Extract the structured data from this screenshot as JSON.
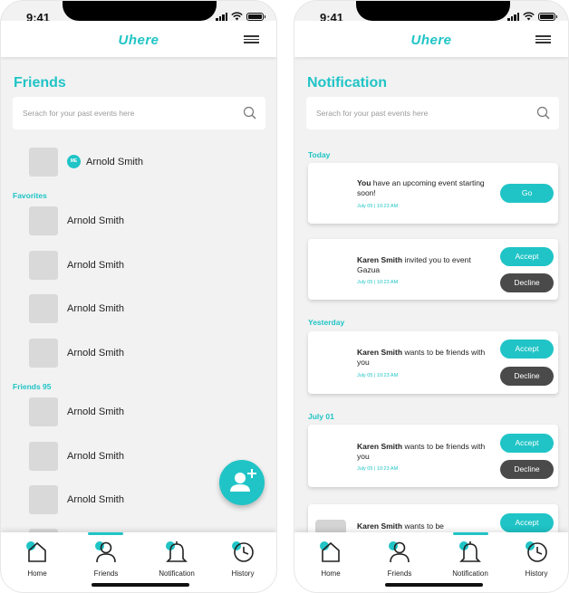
{
  "status_bar": {
    "time": "9:41"
  },
  "app": {
    "logo": "Uhere"
  },
  "friends_screen": {
    "title": "Friends",
    "search": {
      "placeholder": "Serach for your past events here"
    },
    "me": {
      "badge": "ME",
      "name": "Arnold Smith"
    },
    "favorites_label": "Favorites",
    "favorites": [
      "Arnold Smith",
      "Arnold Smith",
      "Arnold Smith",
      "Arnold Smith"
    ],
    "friends_label": "Friends 95",
    "friends": [
      "Arnold Smith",
      "Arnold Smith",
      "Arnold Smith"
    ]
  },
  "notification_screen": {
    "title": "Notification",
    "search": {
      "placeholder": "Serach for your past events here"
    },
    "groups": {
      "today": "Today",
      "yesterday": "Yesterday",
      "july01": "July 01"
    },
    "cards": [
      {
        "bold": "You",
        "text": " have an upcoming event starting soon!",
        "time": "July 05 | 10:23 AM",
        "primary": "Go"
      },
      {
        "bold": "Karen Smith",
        "text": "  invited  you to event Gazua",
        "time": "July 05 | 10:23 AM",
        "primary": "Accept",
        "secondary": "Decline"
      },
      {
        "bold": "Karen Smith",
        "text": " wants to be friends with you",
        "time": "July 05 | 10:23 AM",
        "primary": "Accept",
        "secondary": "Decline"
      },
      {
        "bold": "Karen Smith",
        "text": " wants to be friends with you",
        "time": "July 05 | 10:23 AM",
        "primary": "Accept",
        "secondary": "Decline"
      },
      {
        "bold": "Karen Smith",
        "text": " wants to be",
        "primary": "Accept"
      }
    ]
  },
  "nav": {
    "home": "Home",
    "friends": "Friends",
    "notification": "Notification",
    "history": "History"
  },
  "icons": {
    "menu": "menu-icon",
    "search": "search-icon",
    "add_friend": "add-user-icon",
    "home": "home-icon",
    "friends": "user-icon",
    "notification": "bell-icon",
    "history": "history-icon"
  },
  "colors": {
    "accent": "#20c4c6",
    "decline": "#4a4a4a",
    "background": "#f2f2f2"
  }
}
